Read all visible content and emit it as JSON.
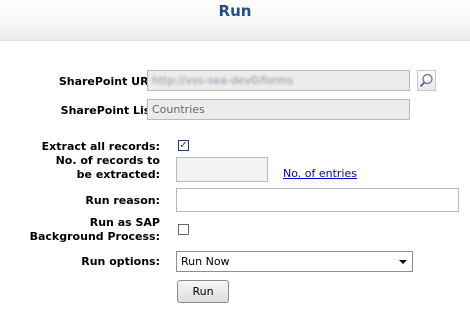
{
  "header": {
    "title": "Run"
  },
  "form": {
    "sharepoint_url": {
      "label": "SharePoint URL:",
      "value": "http://vss-sea-dev0/forms"
    },
    "sharepoint_list": {
      "label": "SharePoint List:",
      "value": "Countries"
    },
    "extract_all": {
      "label": "Extract all records:",
      "checked": true
    },
    "num_records": {
      "label_line1": "No. of records to",
      "label_line2": "be extracted:",
      "value": "",
      "link": "No. of entries"
    },
    "run_reason": {
      "label": "Run reason:",
      "value": ""
    },
    "sap_background": {
      "label_line1": "Run as SAP",
      "label_line2": "Background Process:",
      "checked": false
    },
    "run_options": {
      "label": "Run options:",
      "selected": "Run Now"
    },
    "run_button": "Run"
  },
  "icons": {
    "search": "search-icon",
    "dropdown": "chevron-down-icon",
    "checkbox": "check-icon"
  }
}
